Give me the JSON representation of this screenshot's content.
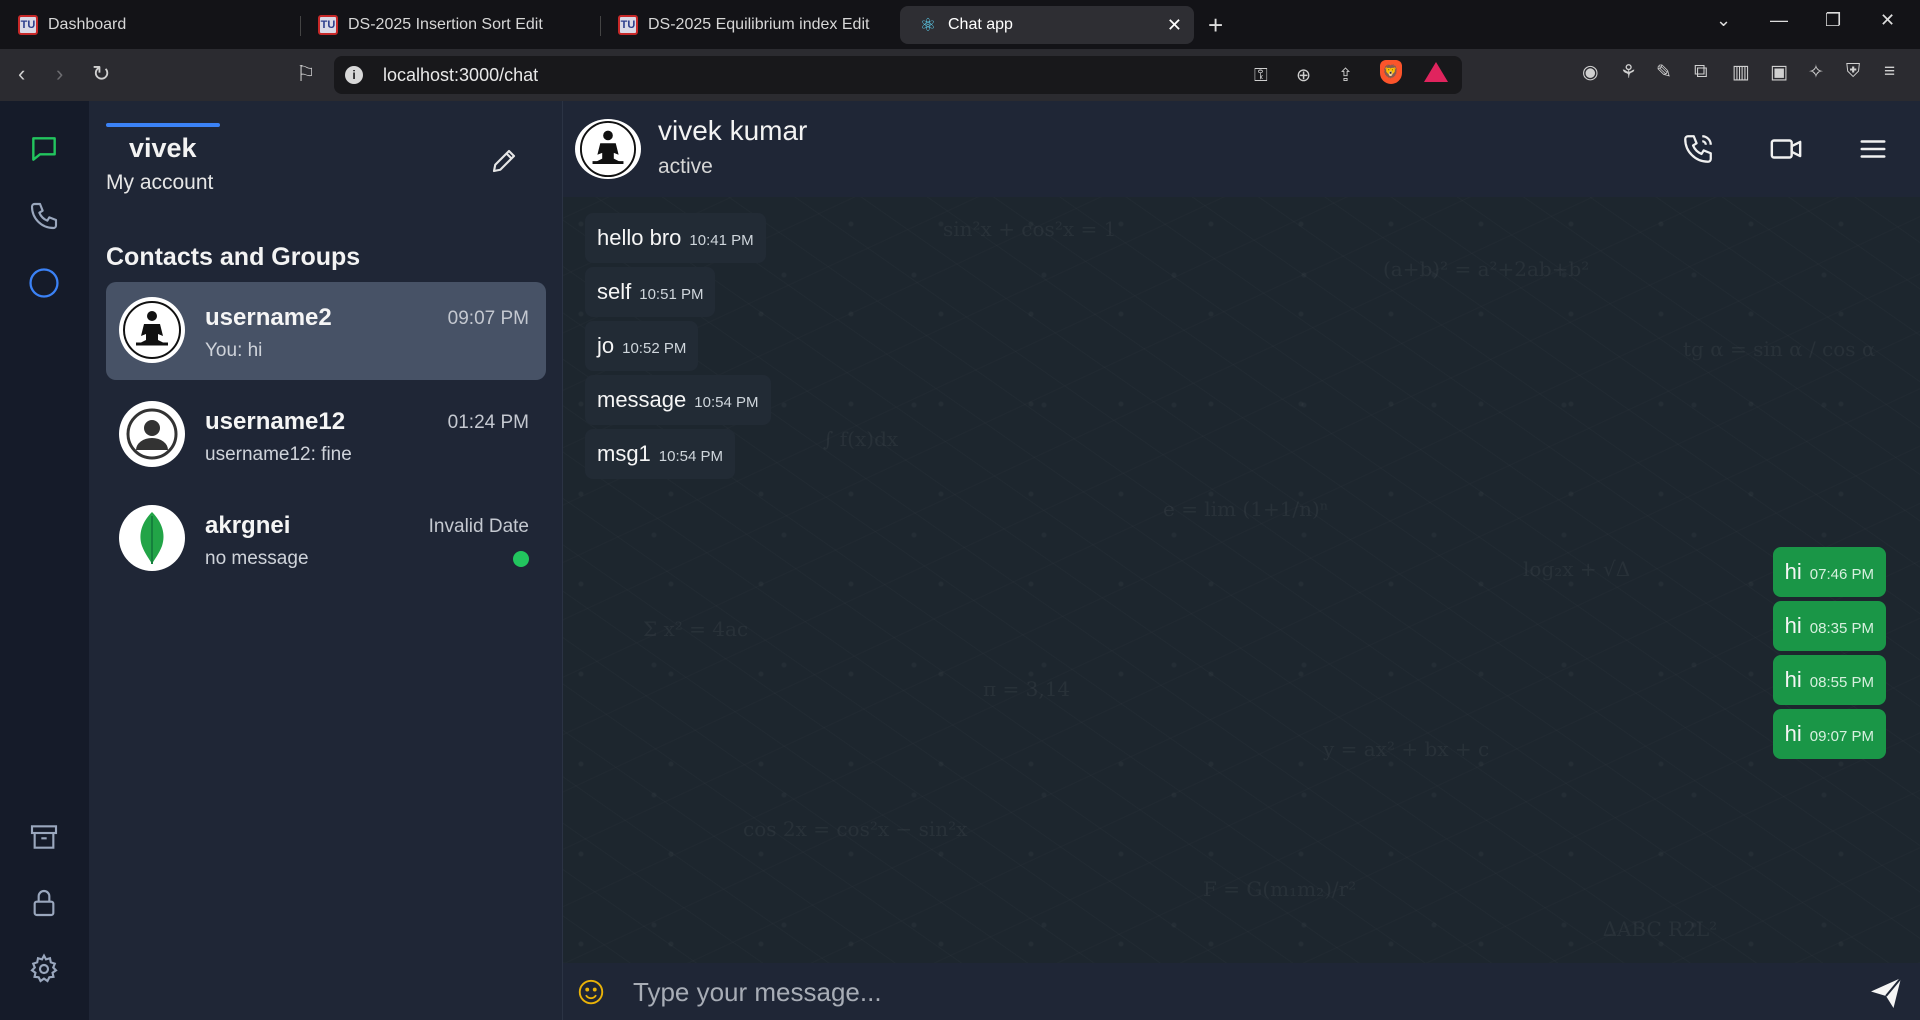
{
  "browser": {
    "tabs": [
      {
        "title": "Dashboard",
        "favicon": "TU",
        "active": false
      },
      {
        "title": "DS-2025 Insertion Sort Edit",
        "favicon": "TU",
        "active": false
      },
      {
        "title": "DS-2025 Equilibrium index Edit",
        "favicon": "TU",
        "active": false
      },
      {
        "title": "Chat app",
        "favicon": "react-icon",
        "active": true
      }
    ],
    "url": "localhost:3000/chat"
  },
  "sidebar_icons": [
    "chat-icon",
    "phone-icon",
    "status-icon",
    "archive-icon",
    "lock-icon",
    "settings-icon"
  ],
  "account": {
    "name": "vivek",
    "subtitle": "My account"
  },
  "contacts": {
    "section_title": "Contacts and Groups",
    "items": [
      {
        "name": "username2",
        "last_message": "You: hi",
        "time": "09:07 PM",
        "selected": true,
        "online": false
      },
      {
        "name": "username12",
        "last_message": "username12: fine",
        "time": "01:24 PM",
        "selected": false,
        "online": false
      },
      {
        "name": "akrgnei",
        "last_message": "no message",
        "time": "Invalid Date",
        "selected": false,
        "online": true
      }
    ]
  },
  "chat": {
    "name": "vivek kumar",
    "status": "active",
    "messages": [
      {
        "direction": "in",
        "text": "hello bro",
        "time": "10:41 PM"
      },
      {
        "direction": "in",
        "text": "self",
        "time": "10:51 PM"
      },
      {
        "direction": "in",
        "text": "jo",
        "time": "10:52 PM"
      },
      {
        "direction": "in",
        "text": "message",
        "time": "10:54 PM"
      },
      {
        "direction": "in",
        "text": "msg1",
        "time": "10:54 PM"
      },
      {
        "direction": "out",
        "text": "hi",
        "time": "07:46 PM"
      },
      {
        "direction": "out",
        "text": "hi",
        "time": "08:35 PM"
      },
      {
        "direction": "out",
        "text": "hi",
        "time": "08:55 PM"
      },
      {
        "direction": "out",
        "text": "hi",
        "time": "09:07 PM"
      }
    ]
  },
  "composer": {
    "placeholder": "Type your message..."
  },
  "colors": {
    "accent_green": "#22c55e",
    "outgoing_bubble": "#1a9647",
    "account_underline": "#3b82f6"
  }
}
